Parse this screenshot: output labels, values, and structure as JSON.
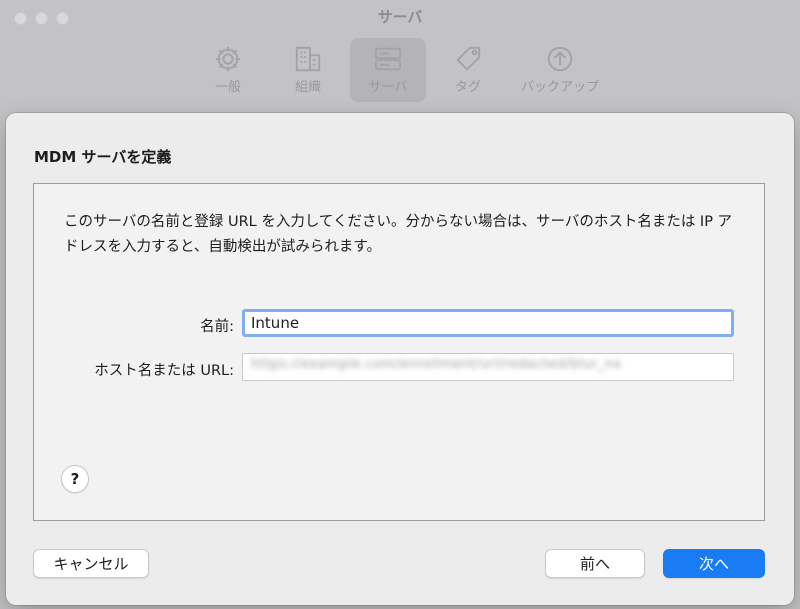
{
  "window": {
    "title": "サーバ",
    "toolbar": [
      {
        "label": "一般",
        "icon": "gear-icon"
      },
      {
        "label": "組織",
        "icon": "building-icon"
      },
      {
        "label": "サーバ",
        "icon": "server-icon",
        "selected": true
      },
      {
        "label": "タグ",
        "icon": "tag-icon"
      },
      {
        "label": "バックアップ",
        "icon": "backup-arrow-icon"
      }
    ]
  },
  "sheet": {
    "title": "MDM サーバを定義",
    "description": "このサーバの名前と登録 URL を入力してください。分からない場合は、サーバのホスト名または IP アドレスを入力すると、自動検出が試みられます。",
    "name_label": "名前:",
    "name_value": "Intune",
    "host_label": "ホスト名または URL:",
    "host_value": "https://example.com/enrollment/url/redacted/blur_nx",
    "help_label": "?",
    "cancel_label": "キャンセル",
    "back_label": "前へ",
    "next_label": "次へ"
  },
  "colors": {
    "accent": "#1a7cf5",
    "focus_ring": "#80aef2"
  }
}
